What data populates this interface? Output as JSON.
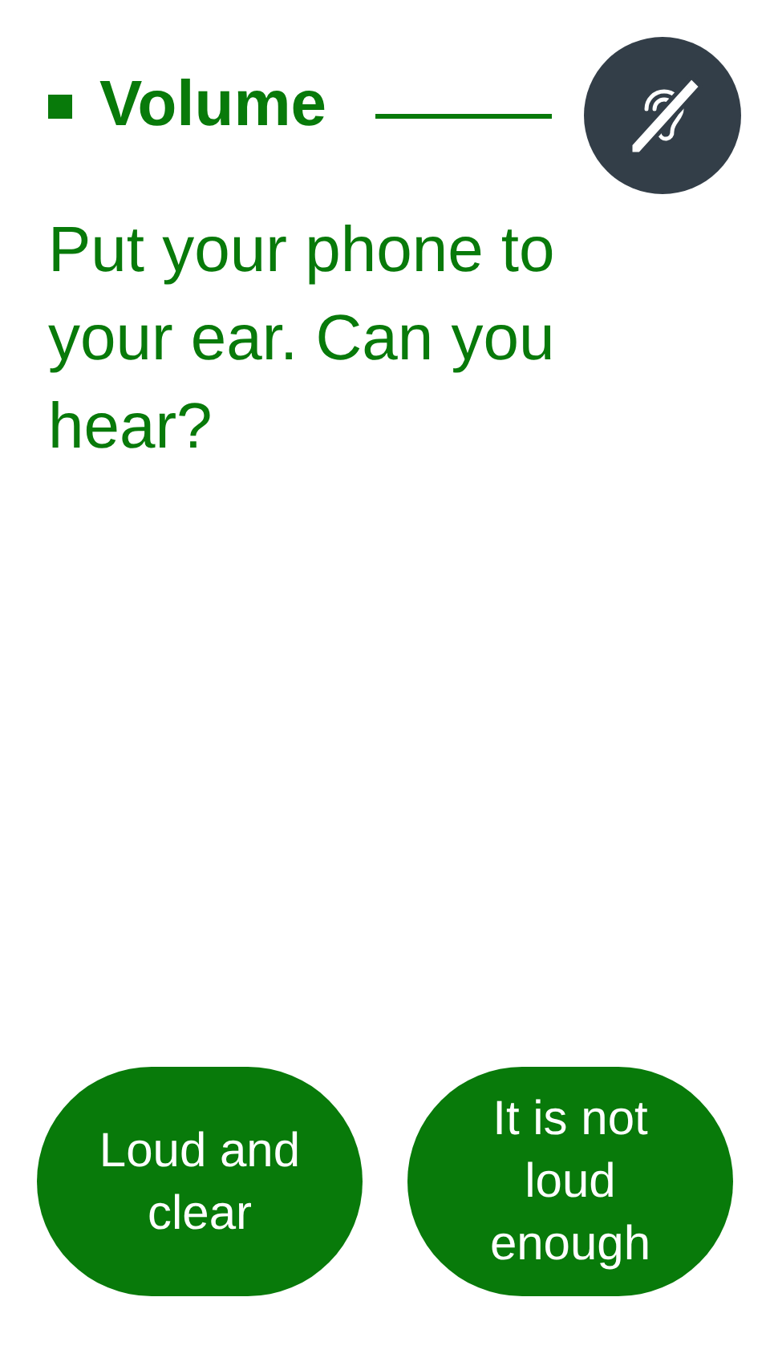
{
  "header": {
    "title": "Volume"
  },
  "question": "Put your phone to your ear. Can you hear?",
  "buttons": [
    {
      "label": "Loud and clear"
    },
    {
      "label": "It is not loud enough"
    }
  ]
}
